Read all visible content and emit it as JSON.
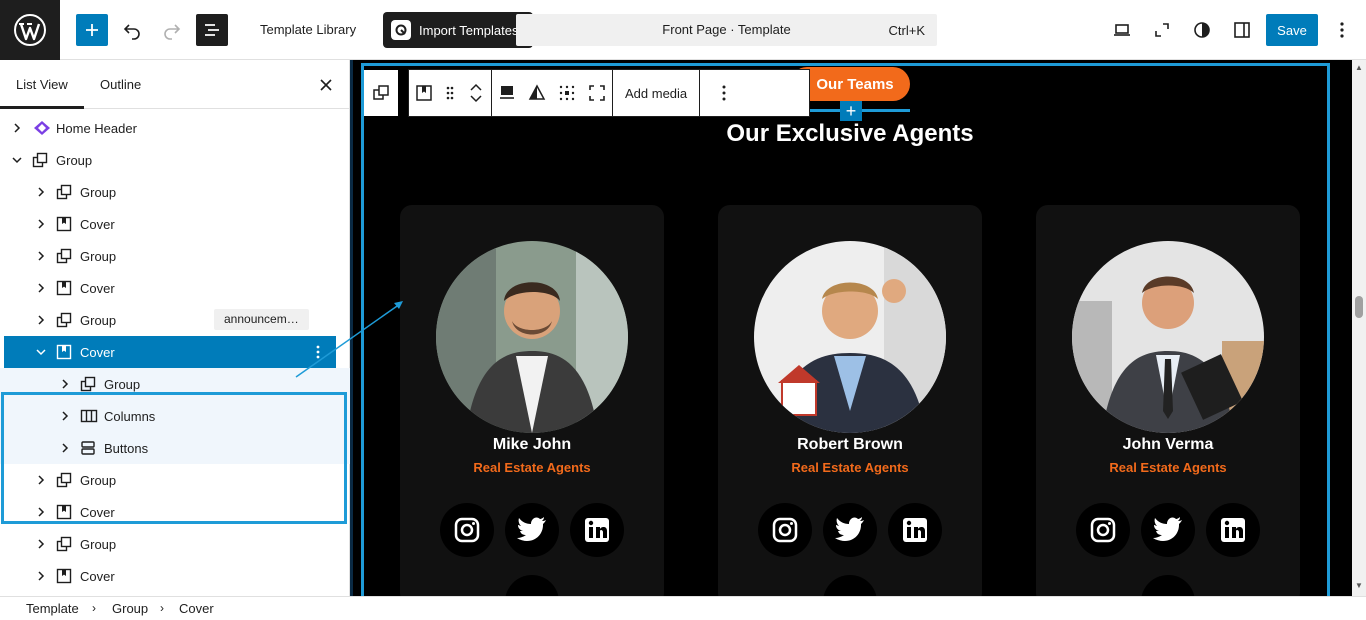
{
  "topbar": {
    "template_library": "Template Library",
    "import_templates": "Import Templates",
    "document_title": "Front Page · Template",
    "shortcut": "Ctrl+K",
    "save_label": "Save"
  },
  "sidebar": {
    "tabs": [
      {
        "label": "List View",
        "active": true
      },
      {
        "label": "Outline",
        "active": false
      }
    ],
    "tree": [
      {
        "label": "Home Header",
        "icon": "pattern-icon",
        "level": 0,
        "expanded": false
      },
      {
        "label": "Group",
        "icon": "group-icon",
        "level": 0,
        "expanded": true
      },
      {
        "label": "Group",
        "icon": "group-icon",
        "level": 1,
        "expanded": false
      },
      {
        "label": "Cover",
        "icon": "cover-icon",
        "level": 1,
        "expanded": false
      },
      {
        "label": "Group",
        "icon": "group-icon",
        "level": 1,
        "expanded": false
      },
      {
        "label": "Cover",
        "icon": "cover-icon",
        "level": 1,
        "expanded": false
      },
      {
        "label": "Group",
        "icon": "group-icon",
        "level": 1,
        "expanded": false,
        "anchor": "announcem…"
      },
      {
        "label": "Cover",
        "icon": "cover-icon",
        "level": 1,
        "expanded": true,
        "selected": true
      },
      {
        "label": "Group",
        "icon": "group-icon",
        "level": 2,
        "expanded": false
      },
      {
        "label": "Columns",
        "icon": "columns-icon",
        "level": 2,
        "expanded": false
      },
      {
        "label": "Buttons",
        "icon": "buttons-icon",
        "level": 2,
        "expanded": false
      },
      {
        "label": "Group",
        "icon": "group-icon",
        "level": 1,
        "expanded": false
      },
      {
        "label": "Cover",
        "icon": "cover-icon",
        "level": 1,
        "expanded": false
      },
      {
        "label": "Group",
        "icon": "group-icon",
        "level": 1,
        "expanded": false
      },
      {
        "label": "Cover",
        "icon": "cover-icon",
        "level": 1,
        "expanded": false
      }
    ]
  },
  "breadcrumb": [
    "Template",
    "Group",
    "Cover"
  ],
  "block_toolbar": {
    "add_media": "Add media"
  },
  "canvas": {
    "button_label": "Our Teams",
    "section_title": "Our Exclusive Agents",
    "agents": [
      {
        "name": "Mike John",
        "role": "Real Estate Agents"
      },
      {
        "name": "Robert Brown",
        "role": "Real Estate Agents"
      },
      {
        "name": "John Verma",
        "role": "Real Estate Agents"
      }
    ]
  },
  "colors": {
    "accent": "#007cba",
    "highlight": "#1e9bd7",
    "orange": "#f26a1b",
    "canvas_bg": "#000000",
    "card_bg": "#111111"
  }
}
